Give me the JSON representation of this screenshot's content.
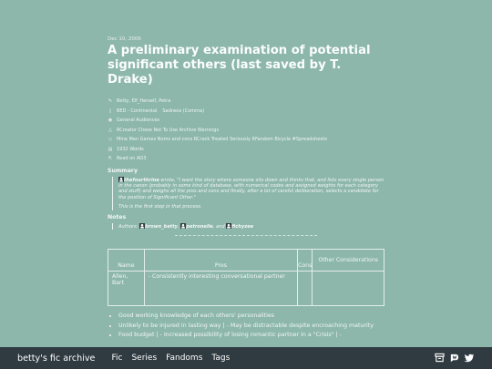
{
  "work": {
    "date": "Dec 10, 2006",
    "title": "A preliminary examination of potential significant others (last saved by T. Drake)"
  },
  "meta": {
    "relationships": "Betty, Elf_Herself, Petra",
    "rating": "BED - Continental",
    "category": "Sadness (Comma)",
    "audience": "General Audiences",
    "warnings": "RCreator Chose Not To Use Archive Warnings",
    "tags": "Mine Men Games Noms and cons RCrack Treated Seriously RFandom Bicycle #Spreadsheets",
    "words": "1932 Words",
    "read": "Read on AO3"
  },
  "summary": {
    "heading": "Summary",
    "author": "thefourthrine",
    "quote": " wrote, \"I want the story where someone sits down and thinks that, and lists every single person in the canon (probably in some kind of database, with numerical codes and assigned weights for each category and stuff) and weighs all the pros and cons and finally, after a lot of careful deliberation, selects a candidate for the position of Significant Other.\"",
    "line2": "This is the first step in that process."
  },
  "notes": {
    "heading": "Notes",
    "prefix": "Authors: ",
    "author1": "brown_betty",
    "sep1": ", ",
    "author2": "petronelle",
    "sep2": ", and ",
    "author3": "fichyzee"
  },
  "table": {
    "headers": {
      "name": "Name",
      "pros": "Pros",
      "cons": "Cons",
      "other": "Other Considerations"
    },
    "row": {
      "name": "Allen, Bart",
      "pros": "- Consistently interesting conversational partner",
      "cons": "",
      "other": ""
    }
  },
  "points": [
    "Good working knowledge of each others' personalities",
    "Unlikely to be injured in lasting way | - May be distractable despite encroaching maturity",
    "Food budget | - Increased possibility of losing romantic partner in a \"Crisis\" | -"
  ],
  "nav": {
    "brand": "betty's fic archive",
    "links": [
      "Fic",
      "Series",
      "Fandoms",
      "Tags"
    ]
  },
  "icons": {
    "archive": "archive-icon",
    "dreamwidth": "dreamwidth-icon",
    "twitter": "twitter-icon"
  },
  "colors": {
    "background": "#8db7ab",
    "navbar": "#2f3a41"
  }
}
